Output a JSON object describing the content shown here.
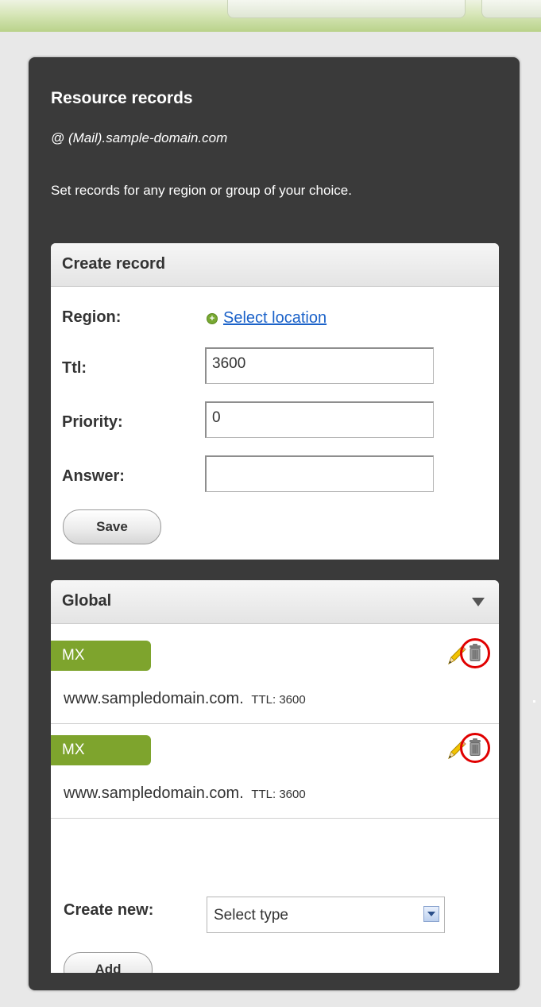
{
  "panel": {
    "title": "Resource records",
    "subtitle": "@ (Mail).sample-domain.com",
    "description": "Set records for any region or group of your choice."
  },
  "create_record": {
    "title": "Create record",
    "region_label": "Region:",
    "region_link": "Select location",
    "ttl_label": "Ttl:",
    "ttl_value": "3600",
    "priority_label": "Priority:",
    "priority_value": "0",
    "answer_label": "Answer:",
    "answer_value": "",
    "save_label": "Save"
  },
  "global": {
    "title": "Global",
    "records": [
      {
        "type": "MX",
        "host": "www.sampledomain.com.",
        "ttl": "TTL: 3600"
      },
      {
        "type": "MX",
        "host": "www.sampledomain.com.",
        "ttl": "TTL: 3600"
      }
    ],
    "create_new_label": "Create new:",
    "select_value": "Select type",
    "add_label": "Add"
  },
  "colors": {
    "panel_bg": "#3a3a3a",
    "record_type_badge": "#7ea42d",
    "link": "#1b62c9",
    "highlight_circle": "#e00000"
  },
  "icons": {
    "plus": "plus-circle-icon",
    "edit": "pencil-icon",
    "delete": "trash-icon",
    "collapse": "triangle-down-icon",
    "dropdown": "chevron-down-icon"
  }
}
